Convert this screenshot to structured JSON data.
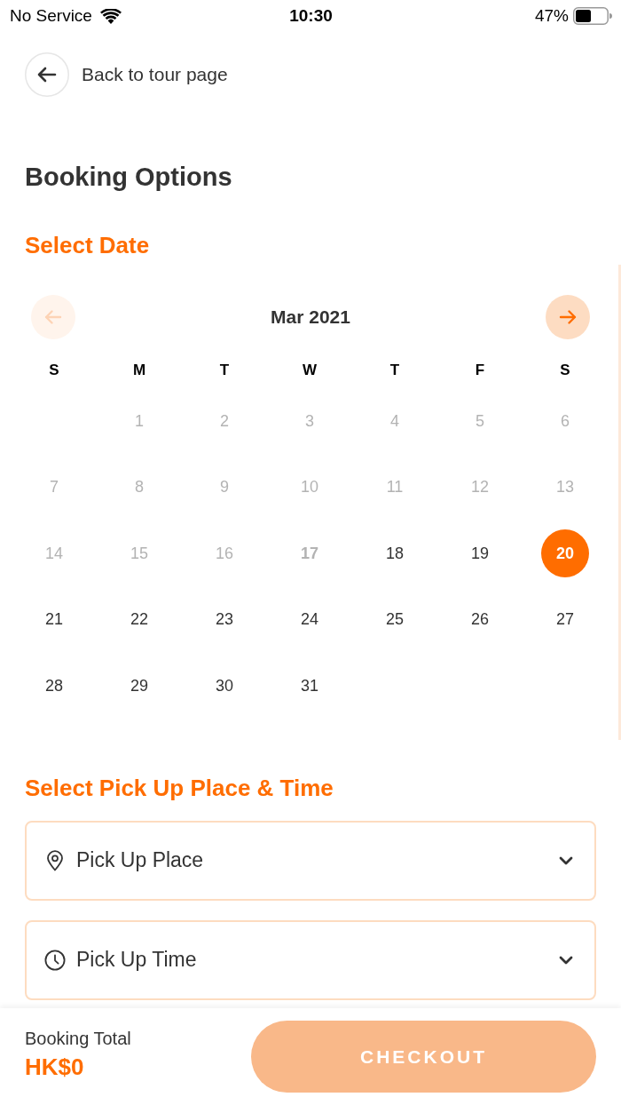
{
  "status_bar": {
    "carrier": "No Service",
    "time": "10:30",
    "battery": "47%"
  },
  "back_link": {
    "label": "Back to tour page"
  },
  "title": "Booking Options",
  "date_section": {
    "heading": "Select Date",
    "calendar": {
      "month": "Mar 2021",
      "prev": {
        "disabled": true
      },
      "next": {
        "disabled": false
      },
      "weekdays": [
        "S",
        "M",
        "T",
        "W",
        "T",
        "F",
        "S"
      ],
      "weeks": [
        {
          "kind": "leading",
          "days": [
            {
              "day": "1",
              "disabled": true,
              "today": false,
              "selected": false
            },
            {
              "day": "2",
              "disabled": true,
              "today": false,
              "selected": false
            },
            {
              "day": "3",
              "disabled": true,
              "today": false,
              "selected": false
            },
            {
              "day": "4",
              "disabled": true,
              "today": false,
              "selected": false
            },
            {
              "day": "5",
              "disabled": true,
              "today": false,
              "selected": false
            },
            {
              "day": "6",
              "disabled": true,
              "today": false,
              "selected": false
            }
          ]
        },
        {
          "kind": "full",
          "days": [
            {
              "day": "7",
              "disabled": true,
              "today": false,
              "selected": false
            },
            {
              "day": "8",
              "disabled": true,
              "today": false,
              "selected": false
            },
            {
              "day": "9",
              "disabled": true,
              "today": false,
              "selected": false
            },
            {
              "day": "10",
              "disabled": true,
              "today": false,
              "selected": false
            },
            {
              "day": "11",
              "disabled": true,
              "today": false,
              "selected": false
            },
            {
              "day": "12",
              "disabled": true,
              "today": false,
              "selected": false
            },
            {
              "day": "13",
              "disabled": true,
              "today": false,
              "selected": false
            }
          ]
        },
        {
          "kind": "full",
          "days": [
            {
              "day": "14",
              "disabled": true,
              "today": false,
              "selected": false
            },
            {
              "day": "15",
              "disabled": true,
              "today": false,
              "selected": false
            },
            {
              "day": "16",
              "disabled": true,
              "today": false,
              "selected": false
            },
            {
              "day": "17",
              "disabled": true,
              "today": true,
              "selected": false
            },
            {
              "day": "18",
              "disabled": false,
              "today": false,
              "selected": false
            },
            {
              "day": "19",
              "disabled": false,
              "today": false,
              "selected": false
            },
            {
              "day": "20",
              "disabled": false,
              "today": false,
              "selected": true
            }
          ]
        },
        {
          "kind": "full",
          "days": [
            {
              "day": "21",
              "disabled": false,
              "today": false,
              "selected": false
            },
            {
              "day": "22",
              "disabled": false,
              "today": false,
              "selected": false
            },
            {
              "day": "23",
              "disabled": false,
              "today": false,
              "selected": false
            },
            {
              "day": "24",
              "disabled": false,
              "today": false,
              "selected": false
            },
            {
              "day": "25",
              "disabled": false,
              "today": false,
              "selected": false
            },
            {
              "day": "26",
              "disabled": false,
              "today": false,
              "selected": false
            },
            {
              "day": "27",
              "disabled": false,
              "today": false,
              "selected": false
            }
          ]
        },
        {
          "kind": "trailing",
          "days": [
            {
              "day": "28",
              "disabled": false,
              "today": false,
              "selected": false
            },
            {
              "day": "29",
              "disabled": false,
              "today": false,
              "selected": false
            },
            {
              "day": "30",
              "disabled": false,
              "today": false,
              "selected": false
            },
            {
              "day": "31",
              "disabled": false,
              "today": false,
              "selected": false
            }
          ]
        }
      ]
    }
  },
  "pickup_section": {
    "heading": "Select Pick Up Place & Time",
    "fields": [
      {
        "kind": "place",
        "placeholder": "Pick Up Place"
      },
      {
        "kind": "time",
        "placeholder": "Pick Up Time"
      }
    ]
  },
  "footer": {
    "total_label": "Booking Total",
    "total": "HK$0",
    "checkout": {
      "label": "CHECKOUT",
      "disabled": true
    }
  }
}
